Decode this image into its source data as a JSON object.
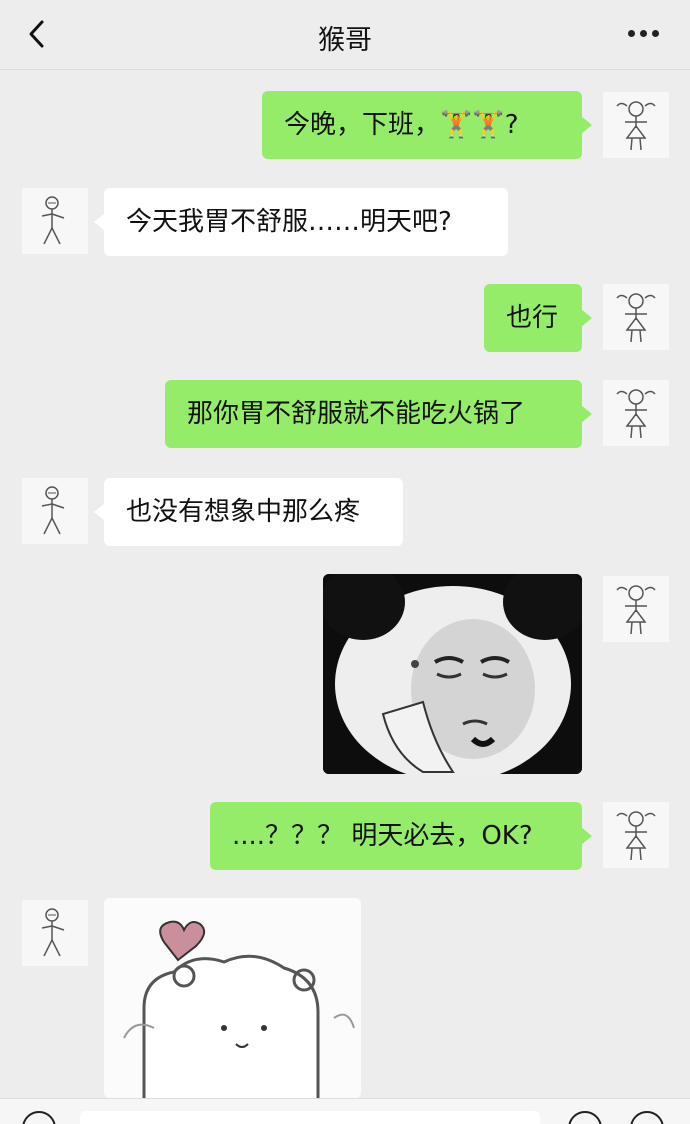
{
  "header": {
    "title": "猴哥",
    "back_icon": "chevron-left-icon",
    "more_icon": "more-dots-icon"
  },
  "messages": [
    {
      "sender": "me",
      "text": "今晚，下班，🏋🏋?"
    },
    {
      "sender": "friend",
      "text": "今天我胃不舒服……明天吧?"
    },
    {
      "sender": "me",
      "text": "也行"
    },
    {
      "sender": "me",
      "text": "那你胃不舒服就不能吃火锅了"
    },
    {
      "sender": "friend",
      "text": "也没有想象中那么疼"
    },
    {
      "sender": "me",
      "sticker": "panda-face-meme"
    },
    {
      "sender": "me",
      "text": "....？？？ 明天必去，OK?"
    },
    {
      "sender": "friend",
      "sticker": "bear-heart-meme"
    }
  ],
  "colors": {
    "my_bubble": "#95ec69",
    "friend_bubble": "#ffffff",
    "background": "#ededed"
  }
}
